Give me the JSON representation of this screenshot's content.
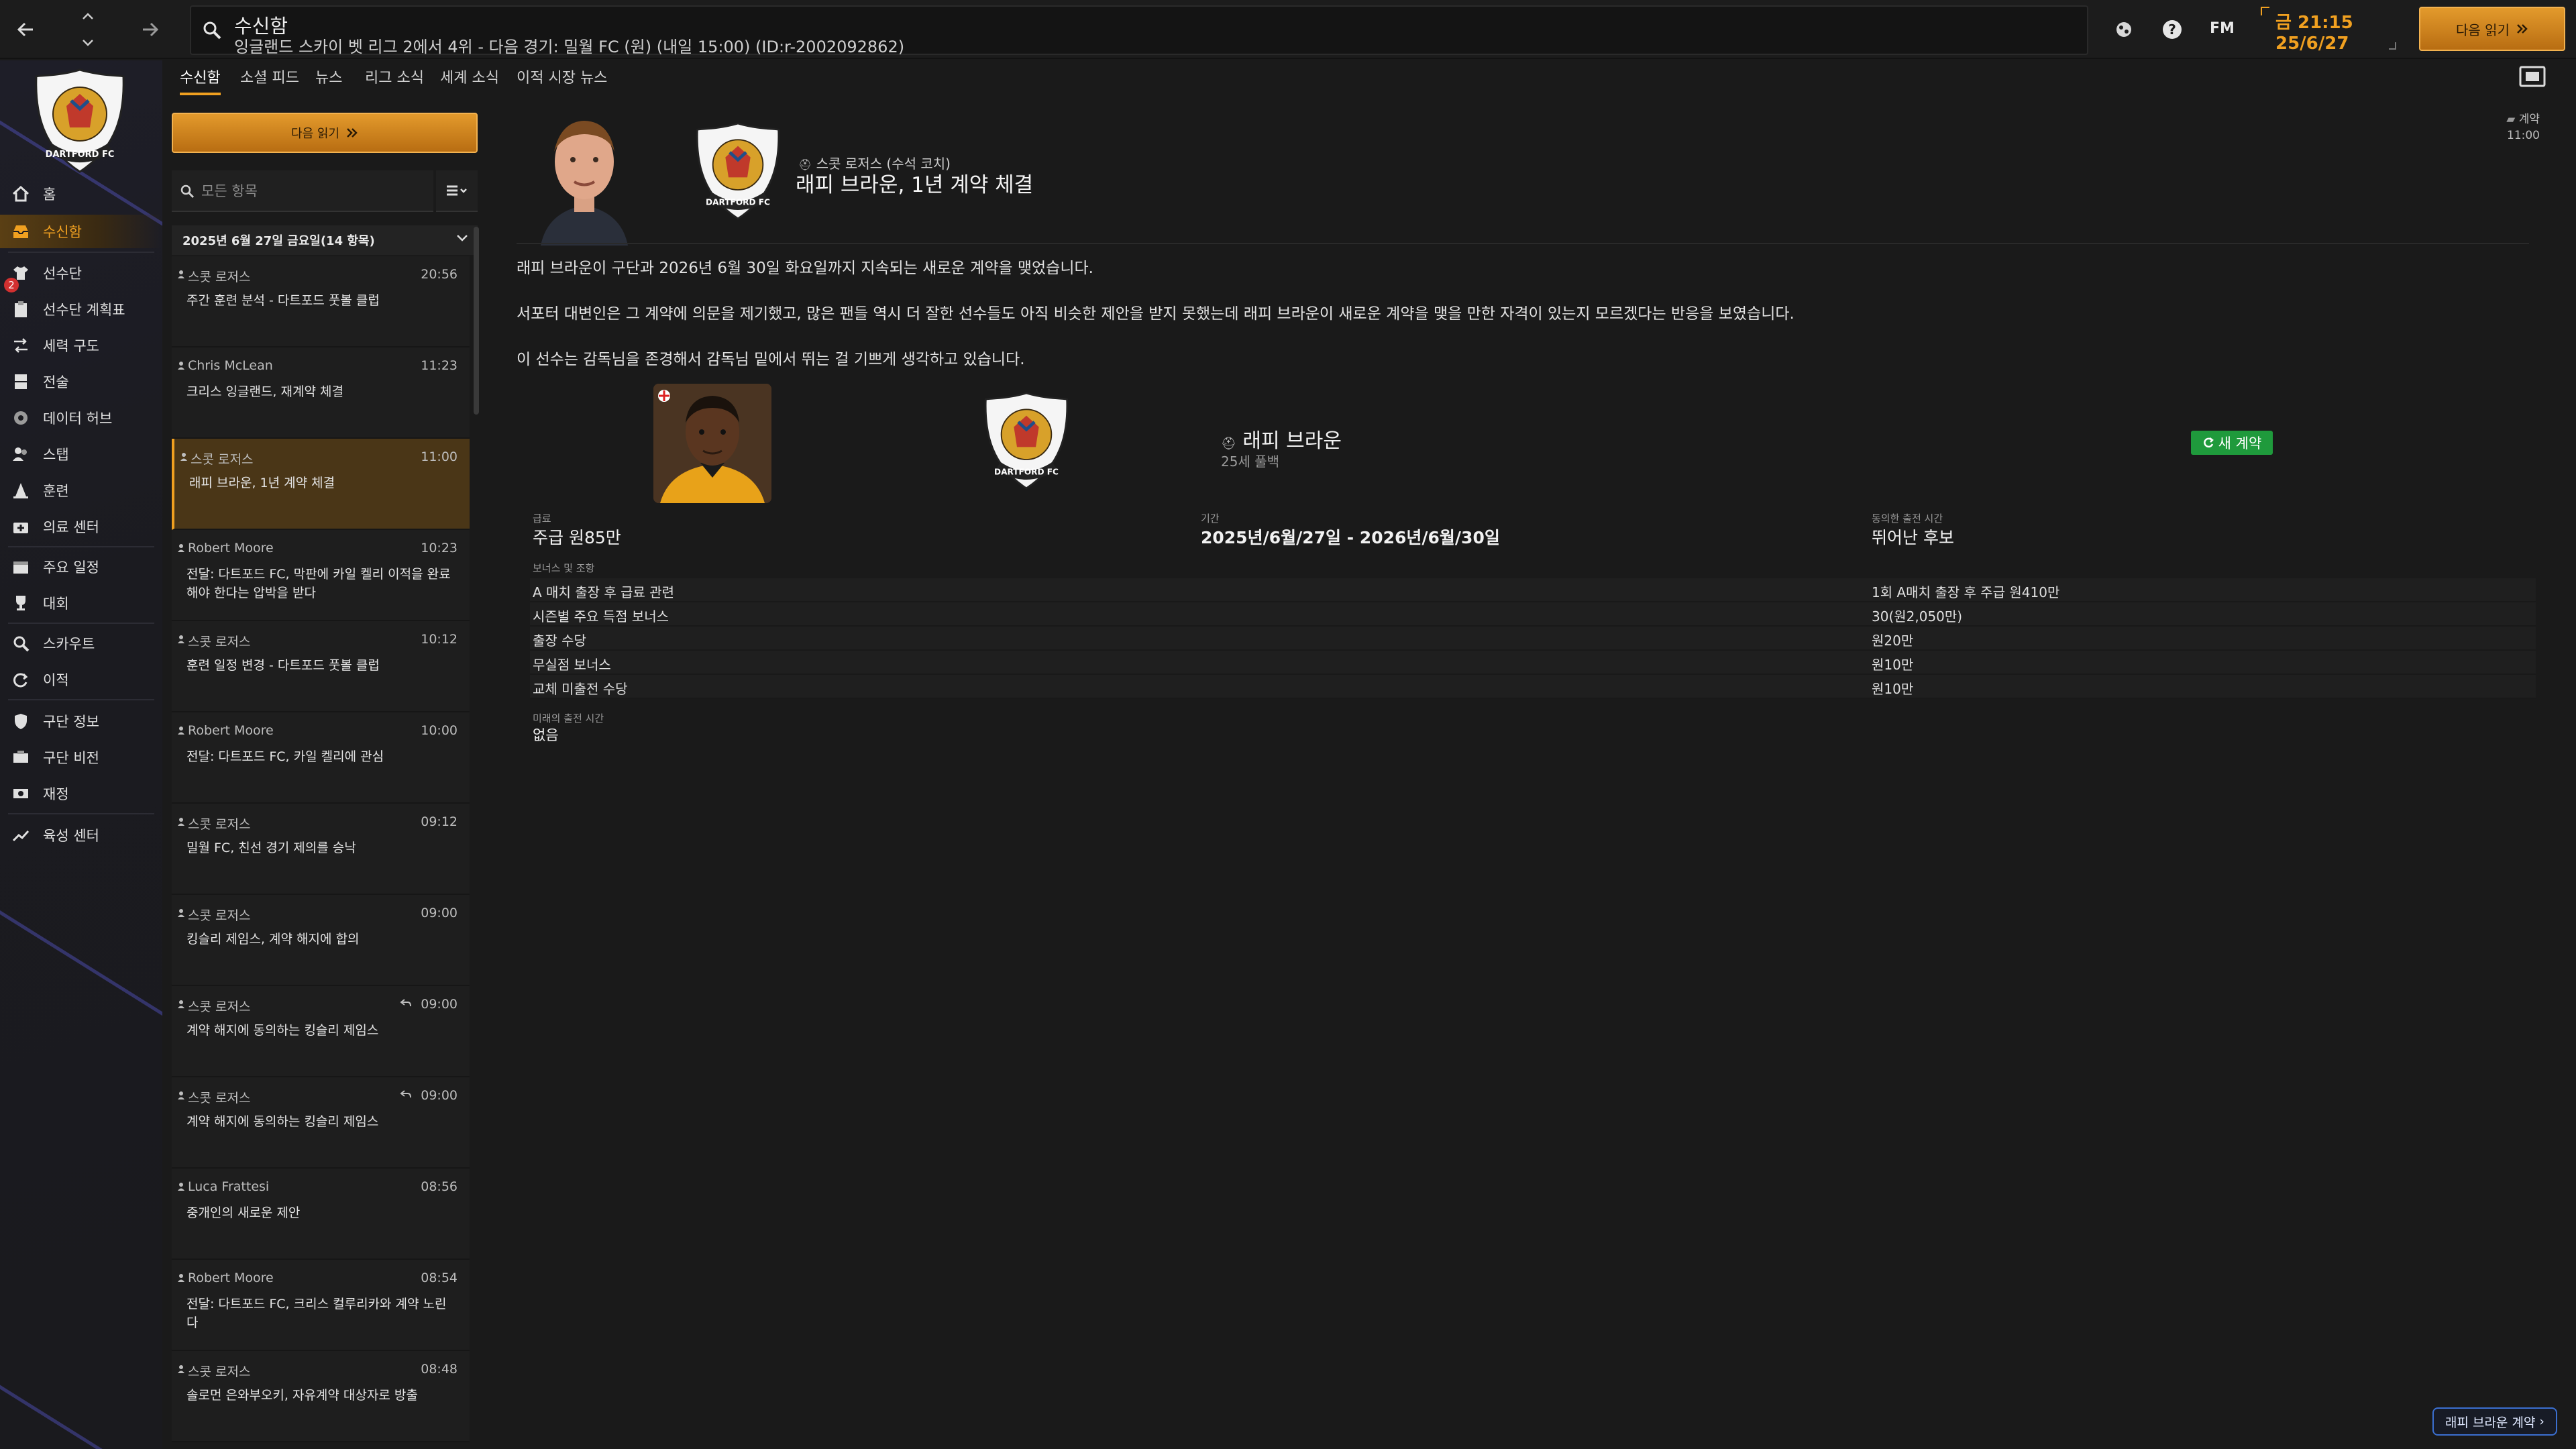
{
  "topbar": {
    "search_title": "수신함",
    "search_subtitle": "잉글랜드 스카이 벳 리그 2에서 4위 - 다음 경기: 밀월 FC (원) (내일 15:00) (ID:r-2002092862)",
    "brand": "FM",
    "time": "금 21:15",
    "date": "25/6/27",
    "continue_label": "다음 읽기"
  },
  "sidebar": {
    "badge_count": "2",
    "items": [
      {
        "label": "홈",
        "icon": "home-icon"
      },
      {
        "label": "수신함",
        "icon": "inbox-icon"
      },
      {
        "label": "선수단",
        "icon": "shirt-icon"
      },
      {
        "label": "선수단 계획표",
        "icon": "clipboard-icon"
      },
      {
        "label": "세력 구도",
        "icon": "dynamics-icon"
      },
      {
        "label": "전술",
        "icon": "tactics-board-icon"
      },
      {
        "label": "데이터 허브",
        "icon": "data-hub-icon"
      },
      {
        "label": "스탭",
        "icon": "staff-icon"
      },
      {
        "label": "훈련",
        "icon": "cone-icon"
      },
      {
        "label": "의료 센터",
        "icon": "medical-icon"
      },
      {
        "label": "주요 일정",
        "icon": "calendar-icon"
      },
      {
        "label": "대회",
        "icon": "trophy-icon"
      },
      {
        "label": "스카우트",
        "icon": "scout-icon"
      },
      {
        "label": "이적",
        "icon": "transfer-icon"
      },
      {
        "label": "구단 정보",
        "icon": "shield-icon"
      },
      {
        "label": "구단 비전",
        "icon": "vision-icon"
      },
      {
        "label": "재정",
        "icon": "finance-icon"
      },
      {
        "label": "육성 센터",
        "icon": "development-icon"
      }
    ]
  },
  "tabs": [
    "수신함",
    "소셜 피드",
    "뉴스",
    "리그 소식",
    "세계 소식",
    "이적 시장 뉴스"
  ],
  "list": {
    "continue_label": "다음 읽기",
    "search_placeholder": "모든 항목",
    "date_header": "2025년 6월 27일 금요일(14 항목)",
    "messages": [
      {
        "sender": "스콧 로저스",
        "time": "20:56",
        "subject": "주간 훈련 분석 - 다트포드 풋볼 클럽",
        "reply": false
      },
      {
        "sender": "Chris McLean",
        "time": "11:23",
        "subject": "크리스 잉글랜드, 재계약 체결",
        "reply": false
      },
      {
        "sender": "스콧 로저스",
        "time": "11:00",
        "subject": "래피 브라운, 1년 계약 체결",
        "reply": false
      },
      {
        "sender": "Robert Moore",
        "time": "10:23",
        "subject": "전달: 다트포드 FC, 막판에 카일 켈리 이적을 완료해야 한다는 압박을 받다",
        "reply": false
      },
      {
        "sender": "스콧 로저스",
        "time": "10:12",
        "subject": "훈련 일정 변경 - 다트포드 풋볼 클럽",
        "reply": false
      },
      {
        "sender": "Robert Moore",
        "time": "10:00",
        "subject": "전달: 다트포드 FC, 카일 켈리에 관심",
        "reply": false
      },
      {
        "sender": "스콧 로저스",
        "time": "09:12",
        "subject": "밀월 FC, 친선 경기 제의를 승낙",
        "reply": false
      },
      {
        "sender": "스콧 로저스",
        "time": "09:00",
        "subject": "킹슬리 제임스, 계약 해지에 합의",
        "reply": false
      },
      {
        "sender": "스콧 로저스",
        "time": "09:00",
        "subject": "계약 해지에 동의하는 킹슬리 제임스",
        "reply": true
      },
      {
        "sender": "스콧 로저스",
        "time": "09:00",
        "subject": "계약 해지에 동의하는 킹슬리 제임스",
        "reply": true
      },
      {
        "sender": "Luca Frattesi",
        "time": "08:56",
        "subject": "중개인의 새로운 제안",
        "reply": false
      },
      {
        "sender": "Robert Moore",
        "time": "08:54",
        "subject": "전달: 다트포드 FC, 크리스 컬루리카와 계약 노린다",
        "reply": false
      },
      {
        "sender": "스콧 로저스",
        "time": "08:48",
        "subject": "솔로먼 은와부오키, 자유계약 대상자로 방출",
        "reply": false
      }
    ]
  },
  "detail": {
    "from": "스콧 로저스 (수석 코치)",
    "title": "래피 브라운, 1년 계약 체결",
    "tag": "계약",
    "tag_time": "11:00",
    "paragraphs": [
      "래피 브라운이 구단과 2026년 6월 30일 화요일까지 지속되는 새로운 계약을 맺었습니다.",
      "서포터 대변인은 그 계약에 의문을 제기했고, 많은 팬들 역시 더 잘한 선수들도 아직 비슷한 제안을 받지 못했는데 래피 브라운이 새로운 계약을 맺을 만한 자격이 있는지 모르겠다는 반응을 보였습니다.",
      "이 선수는 감독님을 존경해서 감독님 밑에서 뛰는 걸 기쁘게 생각하고 있습니다."
    ],
    "card": {
      "player_name": "래피 브라운",
      "player_sub": "25세 풀백",
      "status": "새 계약",
      "wage_label": "급료",
      "wage_value": "주급 원85만",
      "period_label": "기간",
      "period_value": "2025년/6월/27일 - 2026년/6월/30일",
      "role_label": "동의한 출전 시간",
      "role_value": "뛰어난 후보",
      "bonus_header": "보너스 및 조항",
      "bonuses": [
        {
          "label": "A 매치 출장 후 급료 관련",
          "value": "1회 A매치 출장 후 주급 원410만"
        },
        {
          "label": "시즌별 주요 득점 보너스",
          "value": "30(원2,050만)"
        },
        {
          "label": "출장 수당",
          "value": "원20만"
        },
        {
          "label": "무실점 보너스",
          "value": "원10만"
        },
        {
          "label": "교체 미출전 수당",
          "value": "원10만"
        }
      ],
      "future_label": "미래의 출전 시간",
      "future_value": "없음"
    },
    "player_contract_button": "래피 브라운 계약"
  },
  "colors": {
    "accent": "#f0a020",
    "background": "#1a1a1a",
    "selected_row": "#4a3617",
    "status_green": "#1f9a3c"
  }
}
